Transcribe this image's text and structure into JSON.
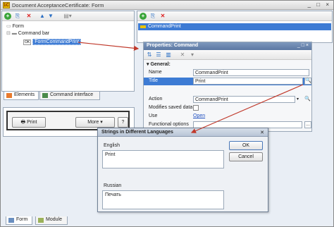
{
  "window": {
    "title": "Document AcceptanceCertificate: Form",
    "controls": "_ □ ×"
  },
  "left_tree": {
    "items": [
      "Form",
      "Command bar",
      "FormCommandPrint"
    ],
    "badge": "OK"
  },
  "left_tabs": [
    "Elements",
    "Command interface"
  ],
  "right_top": {
    "selected": "CommandPrint"
  },
  "properties": {
    "title": "Properties: Command",
    "group": "General:",
    "rows": [
      {
        "label": "Name",
        "value": "CommandPrint"
      },
      {
        "label": "Title",
        "value": "Print"
      },
      {
        "label": "Action",
        "value": "CommandPrint"
      },
      {
        "label": "Modifies saved data",
        "value": ""
      },
      {
        "label": "Use",
        "value": "Open"
      },
      {
        "label": "Functional options",
        "value": ""
      }
    ]
  },
  "preview": {
    "print_label": "Print",
    "more_label": "More",
    "help_label": "?"
  },
  "dialog": {
    "title": "Strings in Different Languages",
    "ok": "OK",
    "cancel": "Cancel",
    "lang1": "English",
    "text1": "Print",
    "lang2": "Russian",
    "text2": "Печать"
  },
  "bottom_tabs": [
    "Form",
    "Module"
  ],
  "colors": {
    "accent": "#3d7bd4",
    "arrow": "#c0392b",
    "props_header": "#5b78a3"
  }
}
